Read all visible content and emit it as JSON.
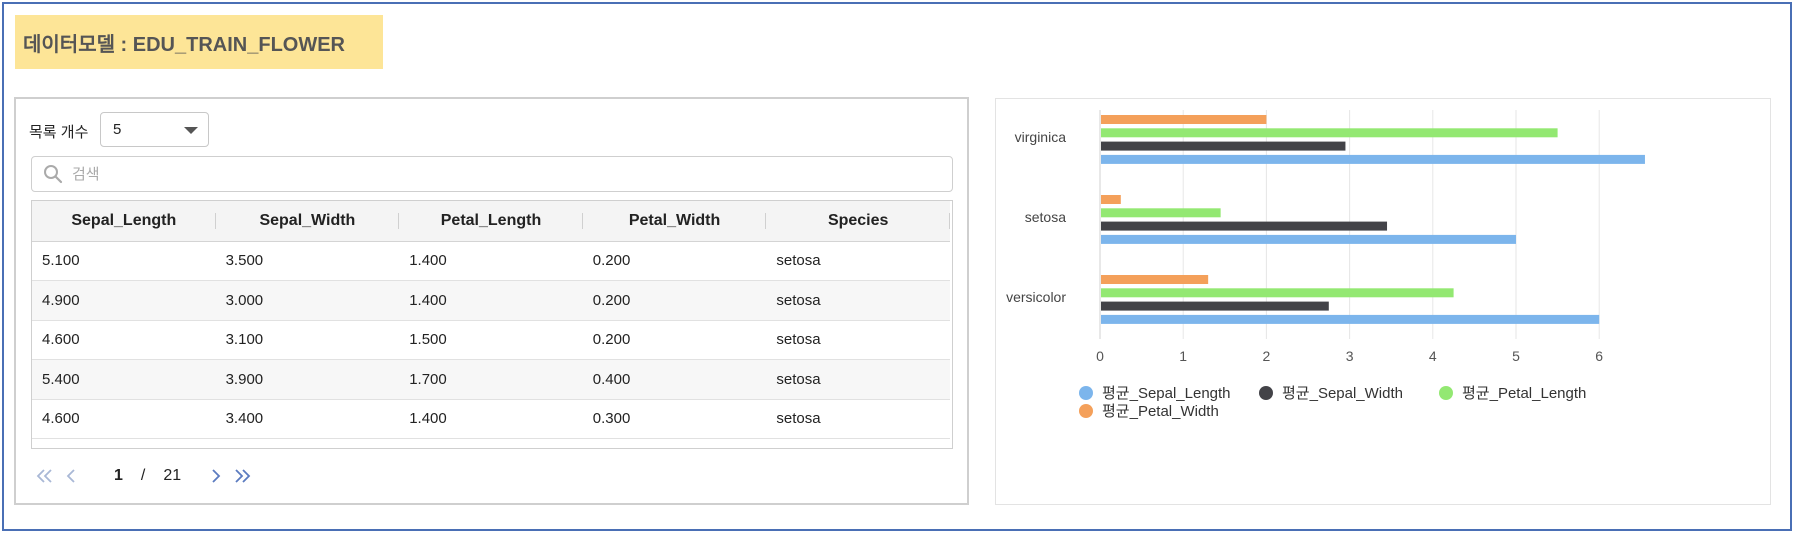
{
  "model_title": "데이터모델 : EDU_TRAIN_FLOWER",
  "table": {
    "rows_label": "목록 개수",
    "rows_value": "5",
    "search_placeholder": "검색",
    "columns": [
      "Sepal_Length",
      "Sepal_Width",
      "Petal_Length",
      "Petal_Width",
      "Species"
    ],
    "rows": [
      [
        "5.100",
        "3.500",
        "1.400",
        "0.200",
        "setosa"
      ],
      [
        "4.900",
        "3.000",
        "1.400",
        "0.200",
        "setosa"
      ],
      [
        "4.600",
        "3.100",
        "1.500",
        "0.200",
        "setosa"
      ],
      [
        "5.400",
        "3.900",
        "1.700",
        "0.400",
        "setosa"
      ],
      [
        "4.600",
        "3.400",
        "1.400",
        "0.300",
        "setosa"
      ]
    ],
    "pagination": {
      "current": "1",
      "separator": "/",
      "total": "21"
    }
  },
  "chart_data": {
    "type": "bar",
    "orientation": "horizontal",
    "categories": [
      "virginica",
      "setosa",
      "versicolor"
    ],
    "series": [
      {
        "name": "평균_Petal_Width",
        "color": "#f4a05a",
        "values": [
          2.0,
          0.25,
          1.3
        ]
      },
      {
        "name": "평균_Petal_Length",
        "color": "#93e872",
        "values": [
          5.5,
          1.45,
          4.25
        ]
      },
      {
        "name": "평균_Sepal_Width",
        "color": "#434348",
        "values": [
          2.95,
          3.45,
          2.75
        ]
      },
      {
        "name": "평균_Sepal_Length",
        "color": "#7cb5ec",
        "values": [
          6.55,
          5.0,
          6.0
        ]
      }
    ],
    "legend_order": [
      "평균_Sepal_Length",
      "평균_Sepal_Width",
      "평균_Petal_Length",
      "평균_Petal_Width"
    ],
    "xlim": [
      0,
      7
    ],
    "xticks": [
      "0",
      "1",
      "2",
      "3",
      "4",
      "5",
      "6"
    ],
    "grid": true,
    "legend_position": "bottom"
  }
}
